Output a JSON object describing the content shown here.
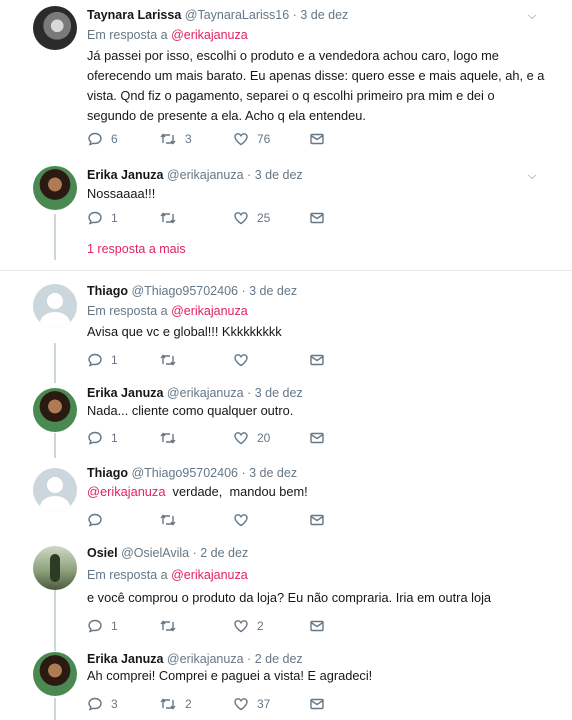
{
  "tweets": [
    {
      "name": "Taynara Larissa",
      "handle": "@TaynaraLariss16",
      "dot": "·",
      "date": "3 de dez",
      "reply_prefix": "Em resposta a",
      "reply_to": "@erikajanuza",
      "text": "Já passei por isso, escolhi o produto e a vendedora achou caro, logo me oferecendo um mais barato.  Eu apenas disse: quero esse e mais aquele, ah, e a vista. Qnd fiz o pagamento, separei o q escolhi primeiro pra mim e dei o segundo de presente a ela. Acho q ela entendeu.",
      "replies": "6",
      "retweets": "3",
      "likes": "76"
    },
    {
      "name": "Erika Januza",
      "handle": "@erikajanuza",
      "dot": "·",
      "date": "3 de dez",
      "text": "Nossaaaa!!!",
      "replies": "1",
      "retweets": "",
      "likes": "25",
      "more": "1 resposta a mais"
    },
    {
      "name": "Thiago",
      "handle": "@Thiago95702406",
      "dot": "·",
      "date": "3 de dez",
      "reply_prefix": "Em resposta a",
      "reply_to": "@erikajanuza",
      "text": "Avisa que vc e global!!!  Kkkkkkkkk",
      "replies": "1",
      "retweets": "",
      "likes": ""
    },
    {
      "name": "Erika Januza",
      "handle": "@erikajanuza",
      "dot": "·",
      "date": "3 de dez",
      "text": "Nada... cliente como qualquer outro.",
      "replies": "1",
      "retweets": "",
      "likes": "20"
    },
    {
      "name": "Thiago",
      "handle": "@Thiago95702406",
      "dot": "·",
      "date": "3 de dez",
      "mention": "@erikajanuza",
      "text": "  verdade,  mandou bem!",
      "replies": "",
      "retweets": "",
      "likes": ""
    },
    {
      "name": "Osiel",
      "handle": "@OsielAvila",
      "dot": "·",
      "date": "2 de dez",
      "reply_prefix": "Em resposta a",
      "reply_to": "@erikajanuza",
      "text": "e você comprou o produto da loja? Eu não compraria. Iria em outra loja",
      "replies": "1",
      "retweets": "",
      "likes": "2"
    },
    {
      "name": "Erika Januza",
      "handle": "@erikajanuza",
      "dot": "·",
      "date": "2 de dez",
      "text": "Ah comprei! Comprei e paguei a vista! E agradeci!",
      "replies": "3",
      "retweets": "2",
      "likes": "37"
    }
  ],
  "icons": {
    "reply": "reply-icon",
    "retweet": "retweet-icon",
    "like": "heart-icon",
    "dm": "envelope-icon",
    "menu": "chevron-down-icon"
  },
  "colors": {
    "link": "#e0245e",
    "muted": "#657786",
    "divider": "#e6ecf0"
  }
}
